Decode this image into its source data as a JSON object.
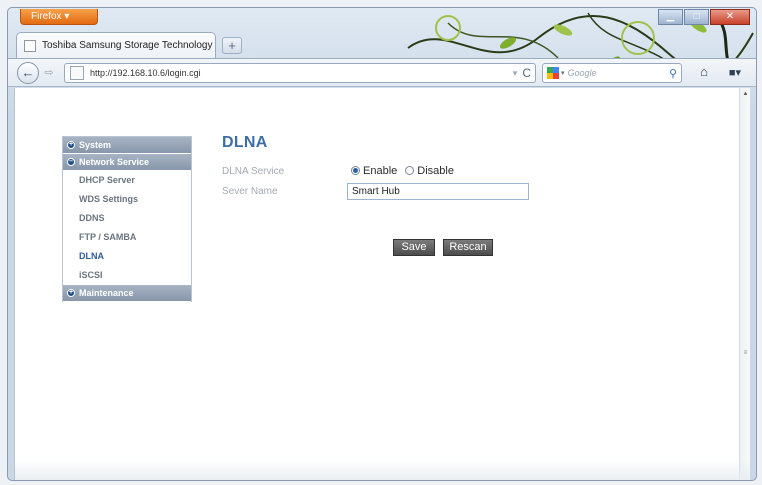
{
  "browser": {
    "menu_button": "Firefox ▾",
    "tab_title": "Toshiba Samsung Storage Technology",
    "url": "http://192.168.10.6/login.cgi",
    "search_placeholder": "Google"
  },
  "sidebar": {
    "sections": [
      {
        "label": "System"
      },
      {
        "label": "Network Service"
      },
      {
        "label": "Maintenance"
      }
    ],
    "items": [
      {
        "label": "DHCP Server"
      },
      {
        "label": "WDS Settings"
      },
      {
        "label": "DDNS"
      },
      {
        "label": "FTP / SAMBA"
      },
      {
        "label": "DLNA",
        "active": true
      },
      {
        "label": "iSCSI"
      }
    ]
  },
  "main": {
    "title": "DLNA",
    "service_label": "DLNA Service",
    "enable_label": "Enable",
    "disable_label": "Disable",
    "service_value": "Enable",
    "server_name_label": "Sever Name",
    "server_name_value": "Smart Hub",
    "save_label": "Save",
    "rescan_label": "Rescan"
  },
  "colors": {
    "accent": "#3e6ea6",
    "sidebar_header": "#8796aa",
    "firefox_button": "#e46a12"
  }
}
